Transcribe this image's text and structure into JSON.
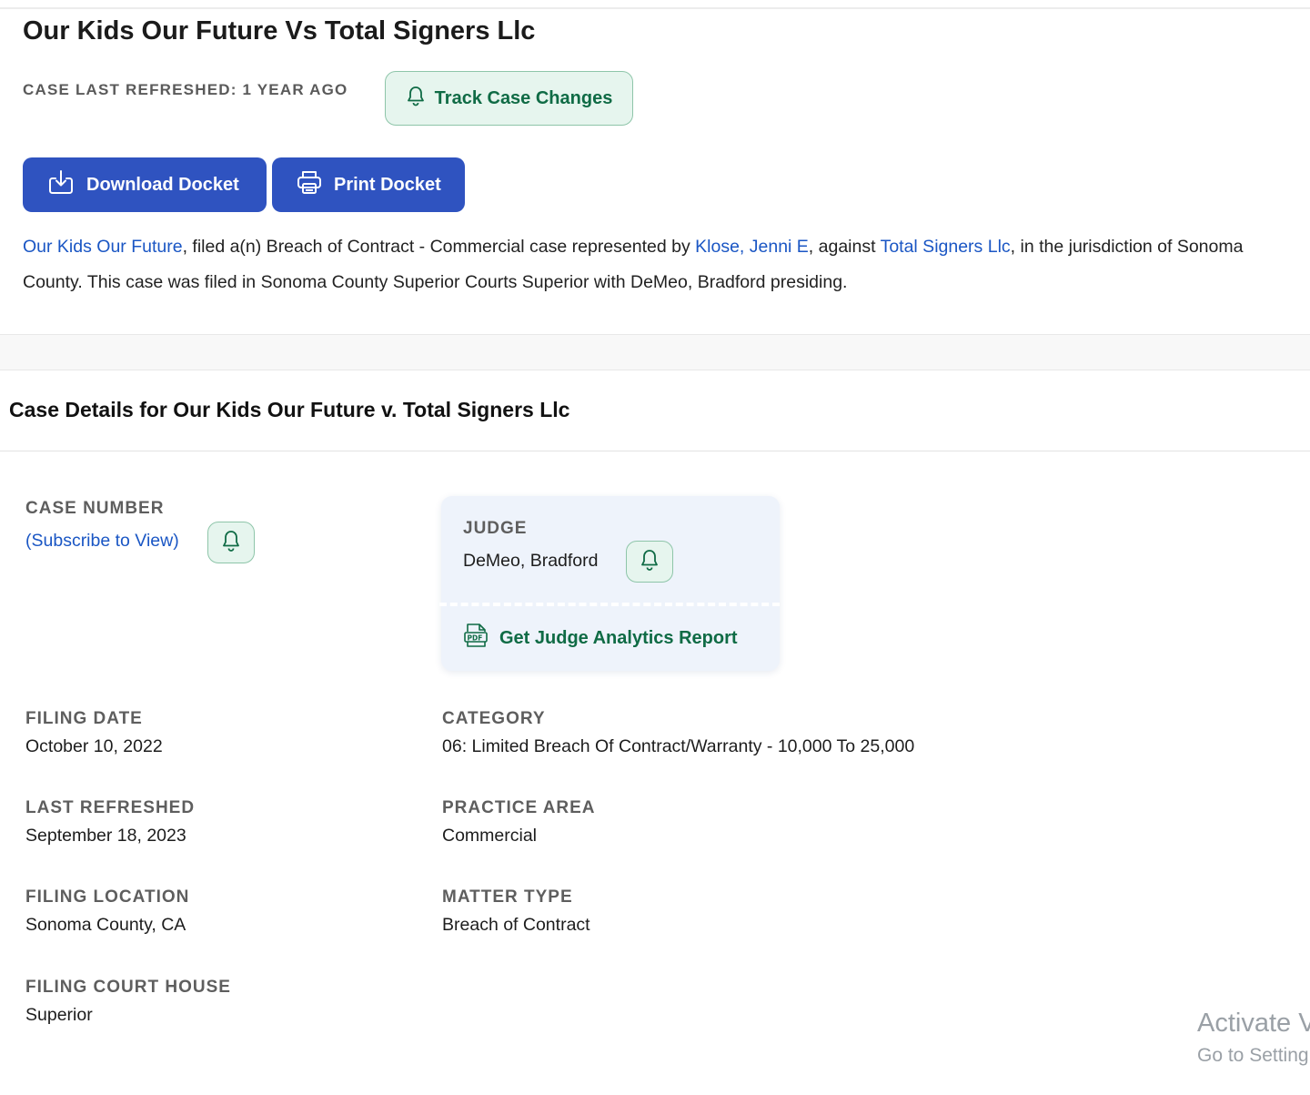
{
  "case": {
    "title": "Our Kids Our Future Vs Total Signers Llc",
    "refreshed_label": "CASE LAST REFRESHED: 1 YEAR AGO",
    "track_label": "Track Case Changes"
  },
  "actions": {
    "download_label": "Download Docket",
    "print_label": "Print Docket"
  },
  "summary": {
    "plaintiff": "Our Kids Our Future",
    "text1": ", filed a(n) Breach of Contract - Commercial case represented by ",
    "attorney": "Klose, Jenni E",
    "text2": ", against ",
    "defendant": "Total Signers Llc",
    "text3": ", in the jurisdiction of Sonoma County. This case was filed in Sonoma County Superior Courts Superior with DeMeo, Bradford presiding."
  },
  "details": {
    "heading": "Case Details for Our Kids Our Future v. Total Signers Llc",
    "case_number_label": "CASE NUMBER",
    "case_number_value": "(Subscribe to View)",
    "judge_label": "JUDGE",
    "judge_value": "DeMeo, Bradford",
    "judge_report_label": "Get Judge Analytics Report",
    "filing_date_label": "FILING DATE",
    "filing_date_value": "October 10, 2022",
    "category_label": "CATEGORY",
    "category_value": "06: Limited Breach Of Contract/Warranty - 10,000 To 25,000",
    "last_refreshed_label": "LAST REFRESHED",
    "last_refreshed_value": "September 18, 2023",
    "practice_area_label": "PRACTICE AREA",
    "practice_area_value": "Commercial",
    "filing_location_label": "FILING LOCATION",
    "filing_location_value": "Sonoma County, CA",
    "matter_type_label": "MATTER TYPE",
    "matter_type_value": "Breach of Contract",
    "court_house_label": "FILING COURT HOUSE",
    "court_house_value": "Superior"
  },
  "watermark": {
    "line1": "Activate V",
    "line2": "Go to Setting"
  },
  "icons": {
    "track": "bell-icon",
    "download": "download-icon",
    "print": "printer-icon",
    "report": "pdf-icon"
  },
  "colors": {
    "primary_button": "#2f53c0",
    "link": "#1a56c4",
    "green_accent": "#0f6b45",
    "green_bg": "#e6f5ee",
    "judge_card_bg": "#eef3fb"
  }
}
